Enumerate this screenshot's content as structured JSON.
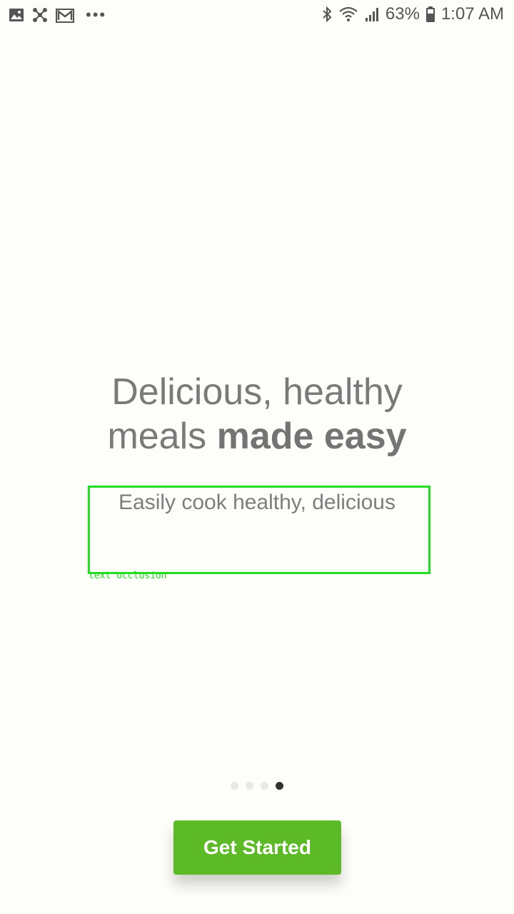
{
  "status_bar": {
    "left_icons": [
      "image-icon",
      "network-hub-icon",
      "gmail-icon"
    ],
    "more": "•••",
    "battery_percent": "63%",
    "time": "1:07 AM",
    "right_icons": [
      "bluetooth-icon",
      "wifi-icon",
      "signal-icon",
      "battery-icon"
    ]
  },
  "onboarding": {
    "headline_line1": "Delicious, healthy",
    "headline_line2_regular": "meals ",
    "headline_line2_bold": "made easy",
    "subtitle": "Easily cook healthy, delicious"
  },
  "annotation": {
    "label": "text occlusion"
  },
  "pager": {
    "total": 4,
    "active_index": 3
  },
  "cta": {
    "label": "Get Started"
  },
  "colors": {
    "background": "#fdfdf9",
    "accent_green": "#5cba26",
    "text_gray": "#7a7a7a",
    "annotation_green": "#22dd22"
  }
}
